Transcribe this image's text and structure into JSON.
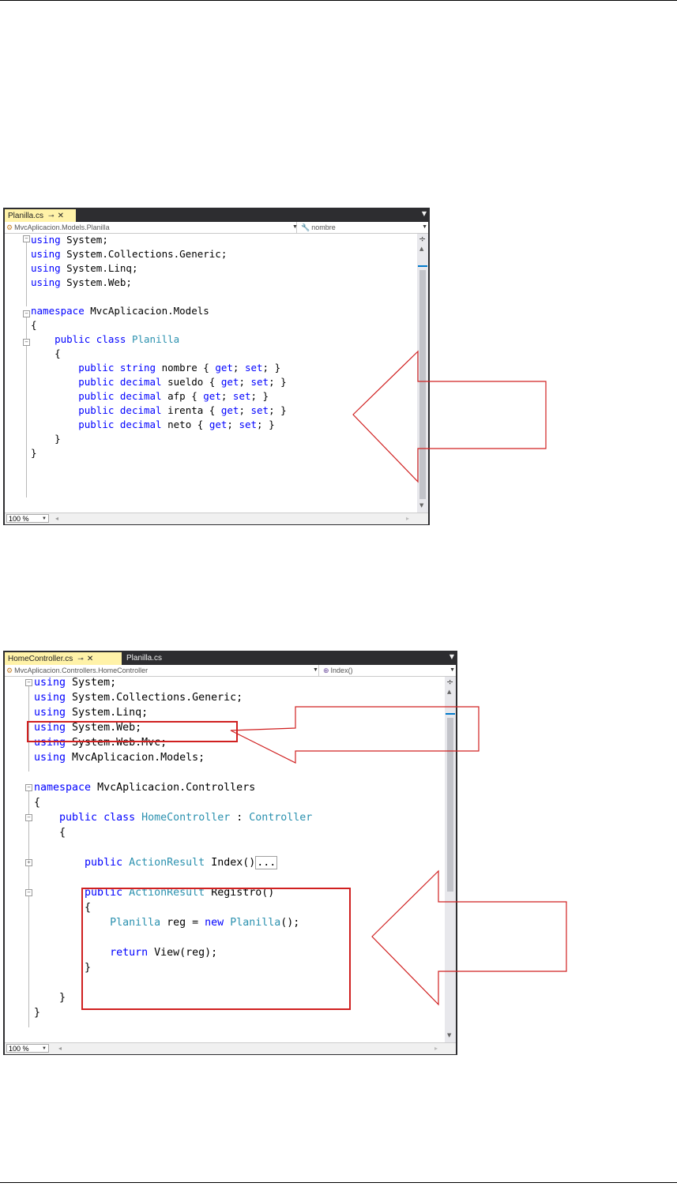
{
  "screenshot1": {
    "tab_active": "Planilla.cs",
    "nav_class": "MvcAplicacion.Models.Planilla",
    "nav_member": "nombre",
    "zoom": "100 %",
    "code": [
      "using System;",
      "using System.Collections.Generic;",
      "using System.Linq;",
      "using System.Web;",
      "",
      "namespace MvcAplicacion.Models",
      "{",
      "    public class Planilla",
      "    {",
      "        public string nombre { get; set; }",
      "        public decimal sueldo { get; set; }",
      "        public decimal afp { get; set; }",
      "        public decimal irenta { get; set; }",
      "        public decimal neto { get; set; }",
      "    }",
      "}"
    ]
  },
  "screenshot2": {
    "tab_active": "HomeController.cs",
    "tab_inactive": "Planilla.cs",
    "nav_class": "MvcAplicacion.Controllers.HomeController",
    "nav_member": "Index()",
    "zoom": "100 %",
    "code": [
      "using System;",
      "using System.Collections.Generic;",
      "using System.Linq;",
      "using System.Web;",
      "using System.Web.Mvc;",
      "using MvcAplicacion.Models;",
      "",
      "namespace MvcAplicacion.Controllers",
      "{",
      "    public class HomeController : Controller",
      "    {",
      "        public ActionResult Index()...",
      "",
      "        public ActionResult Registro()",
      "        {",
      "            Planilla reg = new Planilla();",
      "",
      "            return View(reg);",
      "        }",
      "    }",
      "}"
    ]
  },
  "colors": {
    "keyword": "#0000ff",
    "type": "#2b91af",
    "active_tab": "#fff2a8",
    "chrome": "#2d2d30",
    "annotation": "#d02020"
  },
  "icons": [
    "class-icon",
    "wrench-icon",
    "method-icon",
    "close-icon",
    "pin-icon",
    "chevron-down-icon",
    "split-icon"
  ]
}
